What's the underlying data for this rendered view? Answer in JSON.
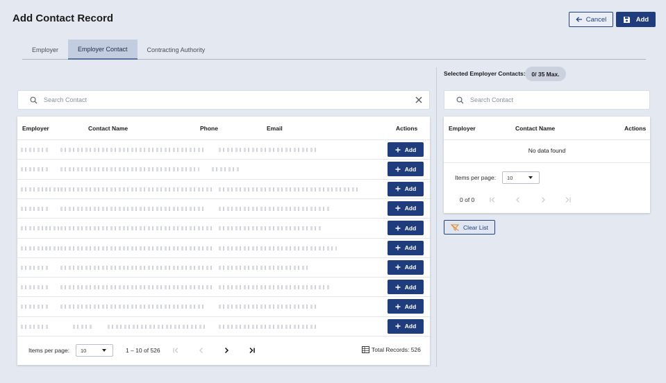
{
  "page": {
    "title": "Add Contact Record"
  },
  "header": {
    "cancel_label": "Cancel",
    "add_label": "Add"
  },
  "tabs": [
    {
      "label": "Employer",
      "active": false
    },
    {
      "label": "Employer Contact",
      "active": true
    },
    {
      "label": "Contracting Authority",
      "active": false
    }
  ],
  "left": {
    "search_placeholder": "Search Contact",
    "columns": [
      "Employer",
      "Contact Name",
      "Phone",
      "Email",
      "Actions"
    ],
    "row_action_label": "Add",
    "row_count": 10,
    "pagination": {
      "items_per_page_label": "Items per page:",
      "page_size": "10",
      "range": "1 – 10 of 526",
      "total_records": "Total Records: 526"
    }
  },
  "right": {
    "selected_label": "Selected Employer Contacts:",
    "selected_count": "0/ 35 Max.",
    "search_placeholder": "Search Contact",
    "columns": [
      "Employer",
      "Contact Name",
      "Actions"
    ],
    "empty_text": "No data found",
    "pagination": {
      "items_per_page_label": "Items per page:",
      "page_size": "10",
      "range": "0 of 0"
    },
    "clear_label": "Clear List"
  },
  "colors": {
    "primary": "#1f3d7c",
    "background": "#e3e8f1",
    "tab_active": "#c3cde0",
    "clear_icon": "#e08a2c"
  },
  "icons": [
    "arrow-left-icon",
    "save-icon",
    "search-icon",
    "close-icon",
    "plus-icon",
    "first-page-icon",
    "prev-page-icon",
    "next-page-icon",
    "last-page-icon",
    "table-icon",
    "clear-filter-icon",
    "chevron-down-icon"
  ]
}
